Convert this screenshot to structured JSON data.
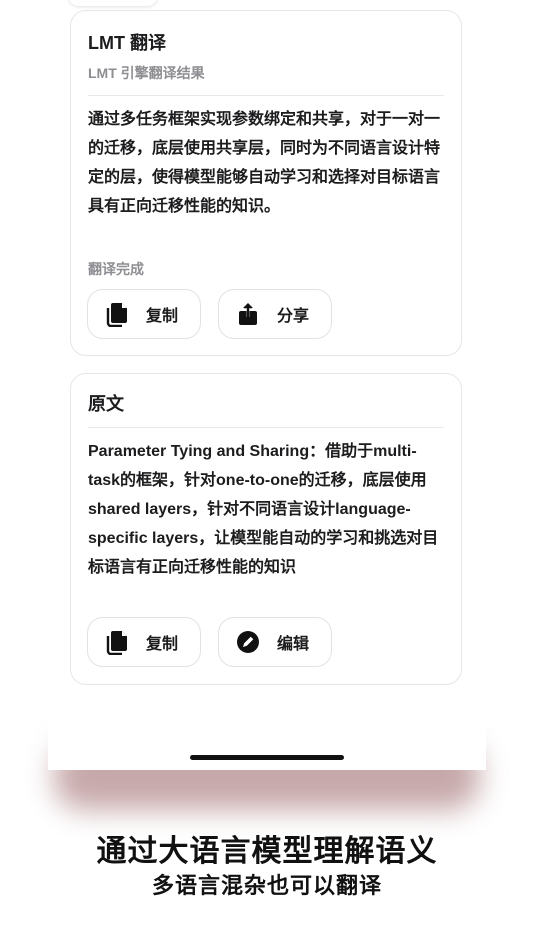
{
  "translation_card": {
    "title": "LMT 翻译",
    "subtitle": "LMT 引擎翻译结果",
    "text": "通过多任务框架实现参数绑定和共享，对于一对一的迁移，底层使用共享层，同时为不同语言设计特定的层，使得模型能够自动学习和选择对目标语言具有正向迁移性能的知识。",
    "status": "翻译完成",
    "copy_label": "复制",
    "share_label": "分享"
  },
  "source_card": {
    "title": "原文",
    "text": "Parameter Tying and Sharing：借助于multi-task的框架，针对one-to-one的迁移，底层使用shared layers，针对不同语言设计language-specific layers，让模型能自动的学习和挑选对目标语言有正向迁移性能的知识",
    "copy_label": "复制",
    "edit_label": "编辑"
  },
  "caption": {
    "main": "通过大语言模型理解语义",
    "sub": "多语言混杂也可以翻译"
  },
  "icons": {
    "copy": "copy-icon",
    "share": "share-icon",
    "edit": "pencil-circle-icon"
  },
  "colors": {
    "shadow": "#b48c8e",
    "text": "#1c1c1e",
    "muted": "#8e8e93",
    "border": "#e6e6e6"
  }
}
